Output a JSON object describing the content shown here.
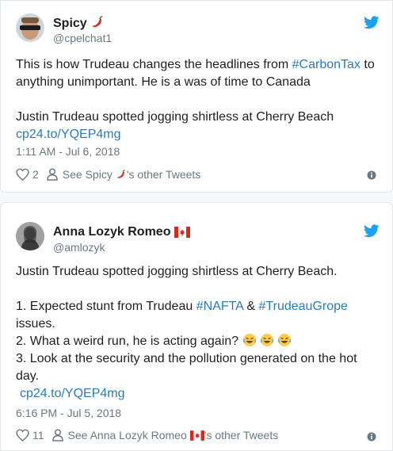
{
  "tweets": [
    {
      "author": "Spicy",
      "author_emoji": "chili-pepper",
      "handle": "@cpelchat1",
      "text_part1": "This is how Trudeau changes the headlines from ",
      "hashtag1": "#CarbonTax",
      "text_part2": " to anything unimportant. He is a was of time to Canada",
      "quoted_headline": "Justin Trudeau spotted jogging shirtless at Cherry Beach",
      "link": "cp24.to/YQEP4mg",
      "timestamp": "1:11 AM - Jul 6, 2018",
      "likes": "2",
      "see_other_prefix": "See Spicy",
      "see_other_suffix": "'s other Tweets"
    },
    {
      "author": "Anna Lozyk Romeo",
      "author_emoji": "canada-flag",
      "handle": "@amlozyk",
      "line1": "Justin Trudeau spotted jogging shirtless at Cherry Beach.",
      "item1_prefix": "1. Expected stunt from Trudeau ",
      "item1_hashtag1": "#NAFTA",
      "item1_mid": " & ",
      "item1_hashtag2": "#TrudeauGrope",
      "item1_suffix": "issues.",
      "item2": "2. What a weird run, he is acting again?",
      "item3": "3. Look at the security and the pollution generated on the hot day.",
      "link": "cp24.to/YQEP4mg",
      "timestamp": "6:16 PM - Jul 5, 2018",
      "likes": "11",
      "see_other_prefix": "See Anna Lozyk Romeo",
      "see_other_suffix": "'s other Tweets"
    }
  ],
  "colors": {
    "twitter_blue": "#1da1f2",
    "link_blue": "#2b7bb9",
    "meta_gray": "#697882",
    "text_dark": "#1c2022",
    "border": "#e1e8ed"
  }
}
